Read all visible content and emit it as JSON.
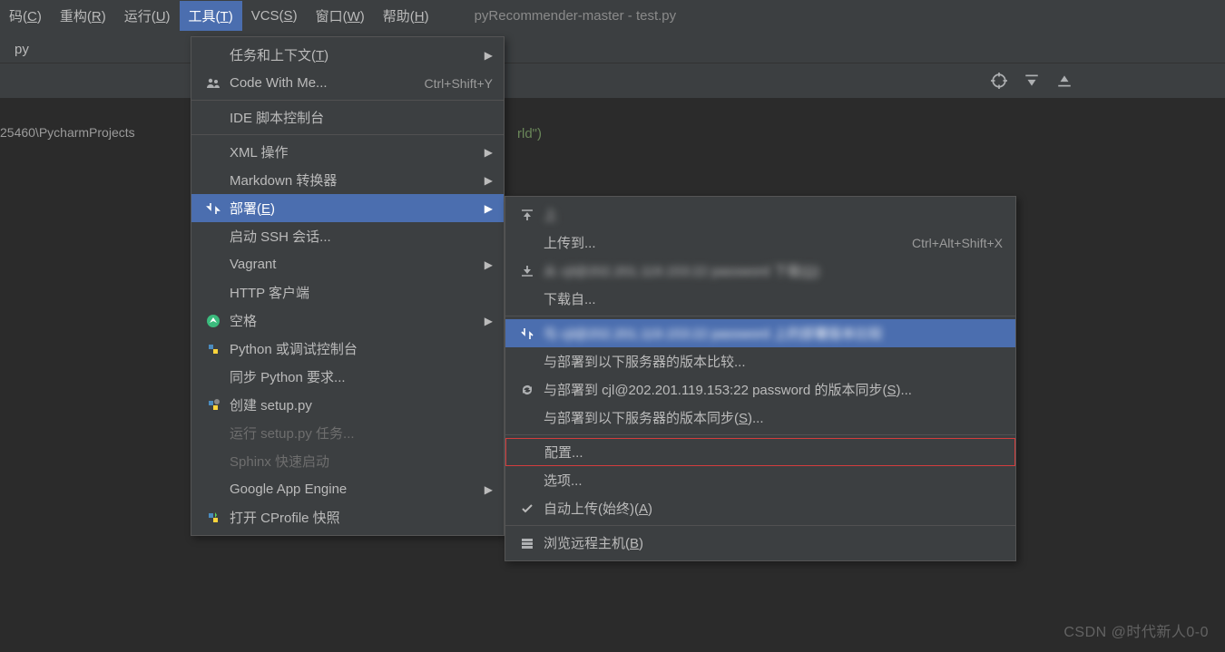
{
  "menubar": {
    "items": [
      {
        "label": "码(C)",
        "underline": "C"
      },
      {
        "label": "重构(R)",
        "underline": "R"
      },
      {
        "label": "运行(U)",
        "underline": "U"
      },
      {
        "label": "工具(T)",
        "underline": "T",
        "selected": true
      },
      {
        "label": "VCS(S)",
        "underline": "S"
      },
      {
        "label": "窗口(W)",
        "underline": "W"
      },
      {
        "label": "帮助(H)",
        "underline": "H"
      }
    ],
    "title": "pyRecommender-master - test.py"
  },
  "tab": {
    "label": "py"
  },
  "path": "25460\\PycharmProjects",
  "code_fragment": "rld\")",
  "tools_menu": {
    "items": [
      {
        "label": "任务和上下文(T)",
        "underline": "T",
        "arrow": true
      },
      {
        "label": "Code With Me...",
        "shortcut": "Ctrl+Shift+Y",
        "icon": "people"
      },
      {
        "sep": true
      },
      {
        "label": "IDE 脚本控制台"
      },
      {
        "sep": true
      },
      {
        "label": "XML 操作",
        "arrow": true
      },
      {
        "label": "Markdown 转换器",
        "arrow": true
      },
      {
        "label": "部署(E)",
        "underline": "E",
        "arrow": true,
        "selected": true,
        "icon": "deploy"
      },
      {
        "label": "启动 SSH 会话..."
      },
      {
        "label": "Vagrant",
        "arrow": true
      },
      {
        "label": "HTTP 客户端"
      },
      {
        "label": "空格",
        "arrow": true,
        "icon": "space"
      },
      {
        "label": "Python 或调试控制台",
        "icon": "pyc"
      },
      {
        "label": "同步 Python 要求..."
      },
      {
        "label": "创建 setup.py",
        "icon": "pyg"
      },
      {
        "label": "运行 setup.py 任务...",
        "disabled": true
      },
      {
        "label": "Sphinx 快速启动",
        "disabled": true
      },
      {
        "label": "Google App Engine",
        "arrow": true
      },
      {
        "label": "打开 CProfile 快照",
        "icon": "pyp"
      }
    ]
  },
  "deploy_menu": {
    "items": [
      {
        "label": "上",
        "blur": true,
        "icon": "upload"
      },
      {
        "label": "上传到...",
        "shortcut": "Ctrl+Alt+Shift+X"
      },
      {
        "label": "从 cjl@202.201.119.153:22 password 下载(D)",
        "blur": true,
        "icon": "download",
        "underline": "D"
      },
      {
        "label": "下载自..."
      },
      {
        "sep": true
      },
      {
        "label": "与 cjl@202.201.119.153:22 password 上的部署版本比较",
        "blur": true,
        "selected": true,
        "icon": "sync"
      },
      {
        "label": "与部署到以下服务器的版本比较..."
      },
      {
        "label": "与部署到 cjl@202.201.119.153:22 password 的版本同步(S)...",
        "underline": "S",
        "icon": "refresh"
      },
      {
        "label": "与部署到以下服务器的版本同步(S)...",
        "underline": "S"
      },
      {
        "sep": true
      },
      {
        "label": "配置...",
        "highlight": true
      },
      {
        "label": "选项..."
      },
      {
        "label": "自动上传(始终)(A)",
        "underline": "A",
        "icon": "check"
      },
      {
        "sep": true
      },
      {
        "label": "浏览远程主机(B)",
        "underline": "B",
        "icon": "host"
      }
    ]
  },
  "watermark": "CSDN @时代新人0-0"
}
